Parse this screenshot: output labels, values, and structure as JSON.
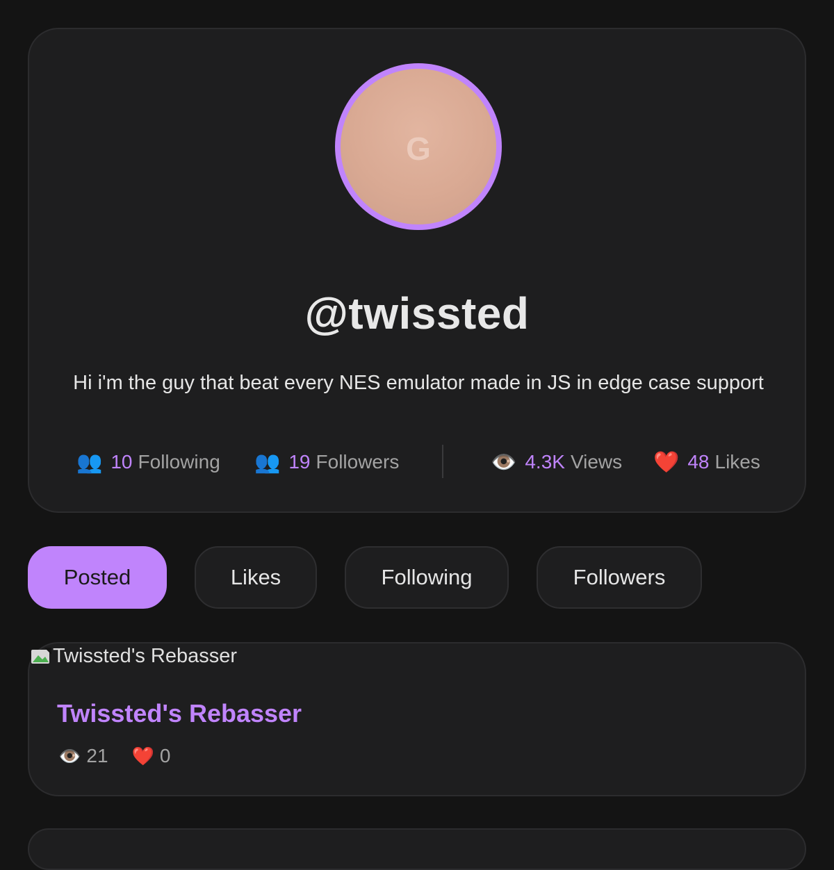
{
  "profile": {
    "avatar_glyph": "G",
    "username": "@twissted",
    "bio": "Hi i'm the guy that beat every NES emulator made in JS in edge case support",
    "stats": {
      "following": {
        "icon": "👥",
        "value": "10",
        "label": "Following"
      },
      "followers": {
        "icon": "👥",
        "value": "19",
        "label": "Followers"
      },
      "views": {
        "icon": "👁️",
        "value": "4.3K",
        "label": "Views"
      },
      "likes": {
        "icon": "❤️",
        "value": "48",
        "label": "Likes"
      }
    }
  },
  "tabs": [
    {
      "label": "Posted",
      "active": true
    },
    {
      "label": "Likes",
      "active": false
    },
    {
      "label": "Following",
      "active": false
    },
    {
      "label": "Followers",
      "active": false
    }
  ],
  "posts": [
    {
      "image_alt": "Twissted's Rebasser",
      "title": "Twissted's Rebasser",
      "views_icon": "👁️",
      "views": "21",
      "likes_icon": "❤️",
      "likes": "0"
    }
  ],
  "colors": {
    "accent": "#c084fc",
    "background": "#141414",
    "card": "#1e1e1f"
  }
}
